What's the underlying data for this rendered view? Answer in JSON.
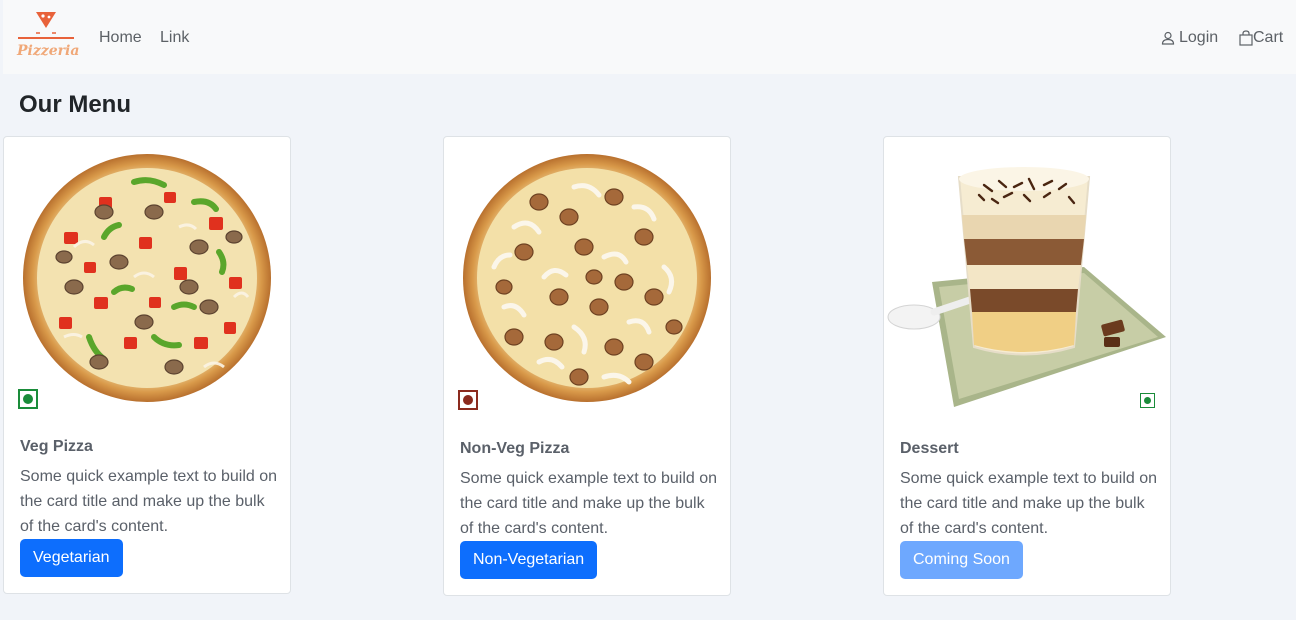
{
  "navbar": {
    "brand_name": "Pizzeria",
    "links": [
      {
        "label": "Home"
      },
      {
        "label": "Link"
      }
    ],
    "login_label": "Login",
    "cart_label": "Cart"
  },
  "page": {
    "title": "Our Menu"
  },
  "cards": [
    {
      "title": "Veg Pizza",
      "text": "Some quick example text to build on the card title and make up the bulk of the card's content.",
      "button_label": "Vegetarian",
      "diet": "veg",
      "button_state": "enabled"
    },
    {
      "title": "Non-Veg Pizza",
      "text": "Some quick example text to build on the card title and make up the bulk of the card's content.",
      "button_label": "Non-Vegetarian",
      "diet": "non-veg",
      "button_state": "enabled"
    },
    {
      "title": "Dessert",
      "text": "Some quick example text to build on the card title and make up the bulk of the card's content.",
      "button_label": "Coming Soon",
      "diet": "veg",
      "button_state": "disabled"
    }
  ],
  "colors": {
    "primary": "#0d6efd",
    "primary_disabled": "#6ea8fe",
    "veg": "#1a8c3a",
    "non_veg": "#8b2a1e",
    "brand": "#e8623a"
  }
}
